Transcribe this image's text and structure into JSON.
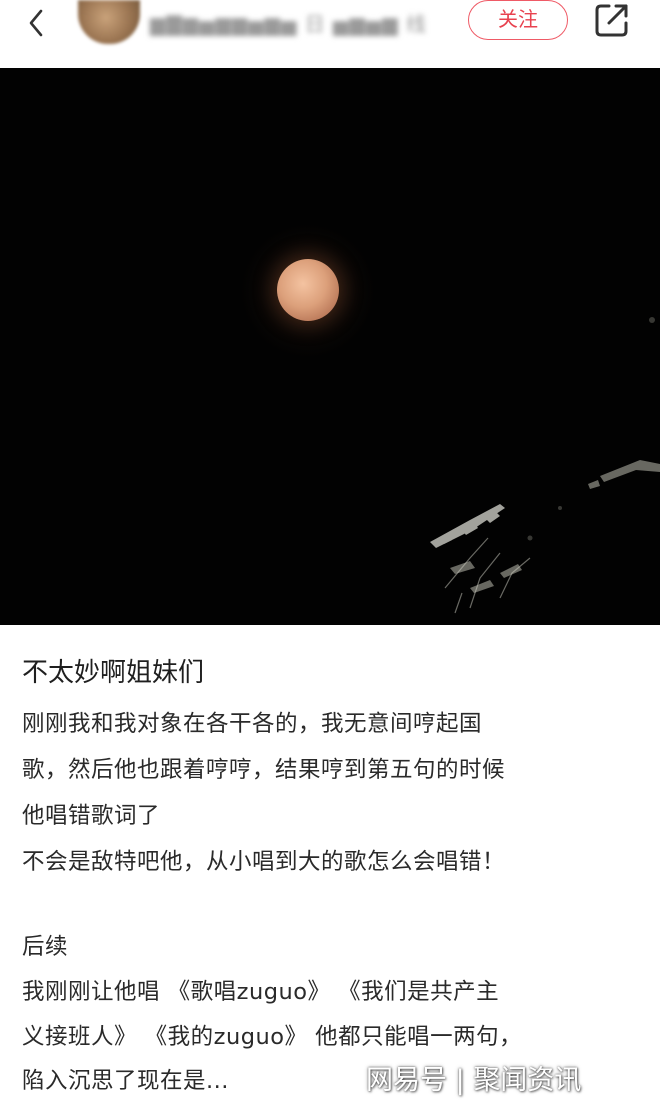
{
  "header": {
    "back_icon": "chevron-left-icon",
    "username": "▆▇▆▅▆▆▅▆▅ 日 ▅▆▅▆ 线",
    "follow_label": "关注",
    "share_icon": "share-external-icon",
    "accent_color": "#e8424f"
  },
  "photo": {
    "subject": "full moon at night",
    "background_color": "#020202",
    "moon_color": "#dca07b"
  },
  "post": {
    "title": "不太妙啊姐妹们",
    "lines": [
      "刚刚我和我对象在各干各的，我无意间哼起国",
      "歌，然后他也跟着哼哼，结果哼到第五句的时候",
      "他唱错歌词了",
      "不会是敌特吧他，从小唱到大的歌怎么会唱错！",
      "",
      "后续",
      "我刚刚让他唱 《歌唱zuguo》  《我们是共产主",
      "义接班人》 《我的zuguo》 他都只能唱一两句，",
      "陷入沉思了现在是..."
    ]
  },
  "watermark": {
    "text": "网易号 | 聚闻资讯"
  }
}
